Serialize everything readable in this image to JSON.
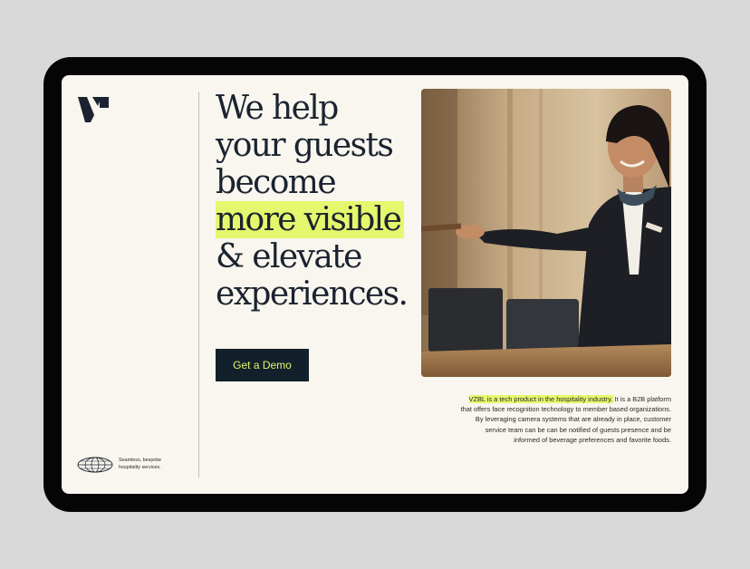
{
  "brand": {
    "logo_icon": "vzbl-mark-icon",
    "accent_color": "#e5f76c",
    "dark_color": "#12202b"
  },
  "hero": {
    "headline_lines": [
      "We help",
      "your guests",
      "become",
      "more visible",
      "& elevate",
      "experiences."
    ],
    "highlighted_line": "more visible",
    "cta_label": "Get a Demo"
  },
  "photo": {
    "icon": "hotel-receptionist-photo"
  },
  "description": {
    "highlight": "VZBL is a tech product in the hospitality industry.",
    "body": " It is a B2B platform that offers face recognition technology to member based organizations. By leveraging camera systems that are already in place, customer service team can be can be notified of guests presence and be informed of beverage preferences and favorite foods."
  },
  "footer": {
    "globe_icon": "globe-icon",
    "tagline_lines": [
      "Seamless, bespoke",
      "hospitality services."
    ]
  }
}
